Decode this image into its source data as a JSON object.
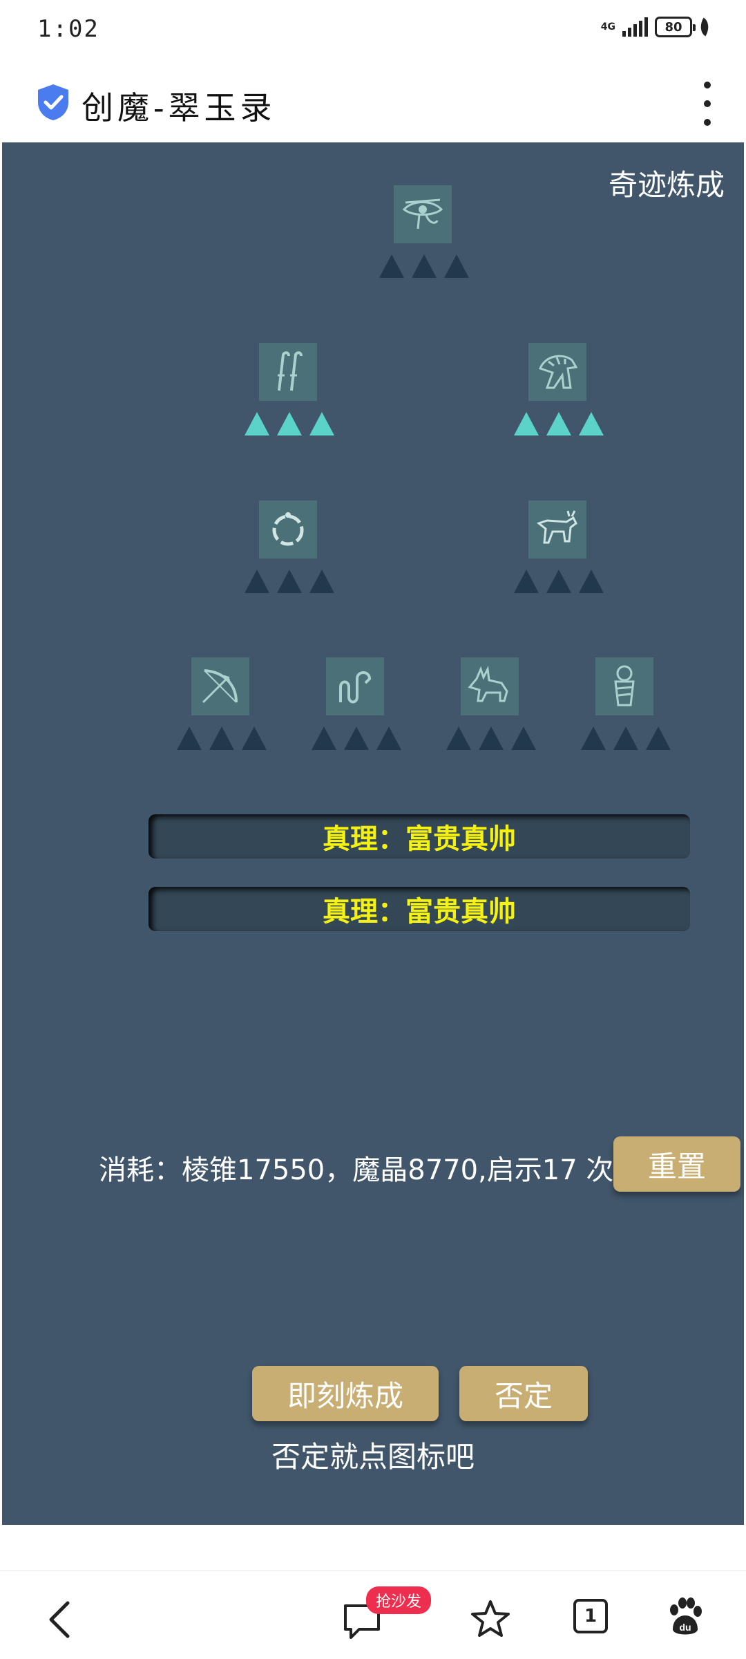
{
  "status_bar": {
    "time": "1:02",
    "network": "4G",
    "battery": "80"
  },
  "header": {
    "title": "创魔-翠玉录"
  },
  "game": {
    "title": "奇迹炼成",
    "nodes": [
      {
        "icon": "eye-of-horus-icon",
        "lit": 0
      },
      {
        "icon": "was-scepters-icon",
        "lit": 3
      },
      {
        "icon": "lion-head-icon",
        "lit": 3
      },
      {
        "icon": "ouroboros-ring-icon",
        "lit": 0
      },
      {
        "icon": "bull-icon",
        "lit": 0
      },
      {
        "icon": "bow-arrow-icon",
        "lit": 0
      },
      {
        "icon": "serpent-icon",
        "lit": 0
      },
      {
        "icon": "anubis-jackal-icon",
        "lit": 0
      },
      {
        "icon": "mummy-icon",
        "lit": 0
      }
    ],
    "result_1": "真理：富贵真帅",
    "result_2": "真理：富贵真帅",
    "cost": "消耗：棱锥17550，魔晶8770,启示17 次",
    "reset_label": "重置",
    "instant_label": "即刻炼成",
    "deny_label": "否定",
    "hint": "否定就点图标吧",
    "colors": {
      "panel": "#41566a",
      "tri_off": "#22384b",
      "tri_on": "#5cd3c8",
      "result_text": "#f5f212",
      "button": "#c9ae74"
    }
  },
  "bottom_nav": {
    "badge": "抢沙发",
    "tab_count": "1"
  }
}
